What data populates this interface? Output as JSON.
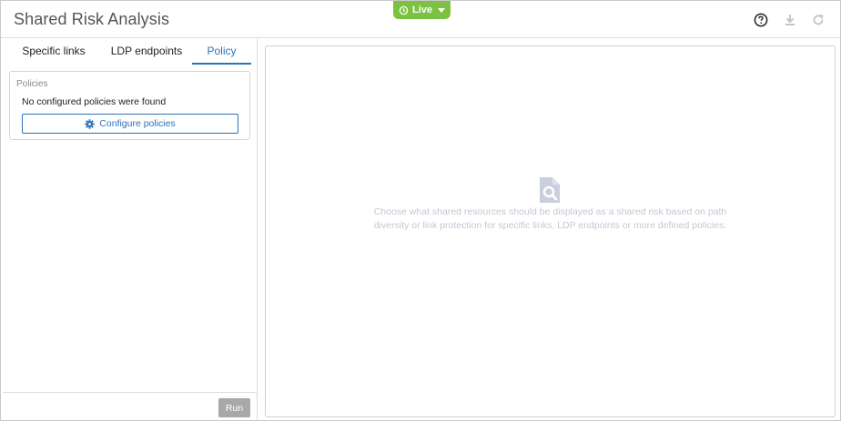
{
  "header": {
    "title": "Shared Risk Analysis",
    "live_label": "Live",
    "icons": [
      "help-icon",
      "download-icon",
      "refresh-icon"
    ]
  },
  "tabs": [
    {
      "label": "Specific links",
      "active": false
    },
    {
      "label": "LDP endpoints",
      "active": false
    },
    {
      "label": "Policy",
      "active": true
    }
  ],
  "policies": {
    "label": "Policies",
    "empty_message": "No configured policies were found",
    "configure_label": "Configure policies"
  },
  "footer": {
    "run_label": "Run"
  },
  "main": {
    "empty_line1": "Choose what shared resources should be displayed as a shared risk based on path",
    "empty_line2": "diversity or link protection for specific links, LDP endpoints or more defined policies."
  },
  "colors": {
    "accent": "#2a73b7",
    "live": "#7cc242",
    "run_disabled": "#a8a8a8",
    "placeholder_text": "#c3c8d4"
  }
}
